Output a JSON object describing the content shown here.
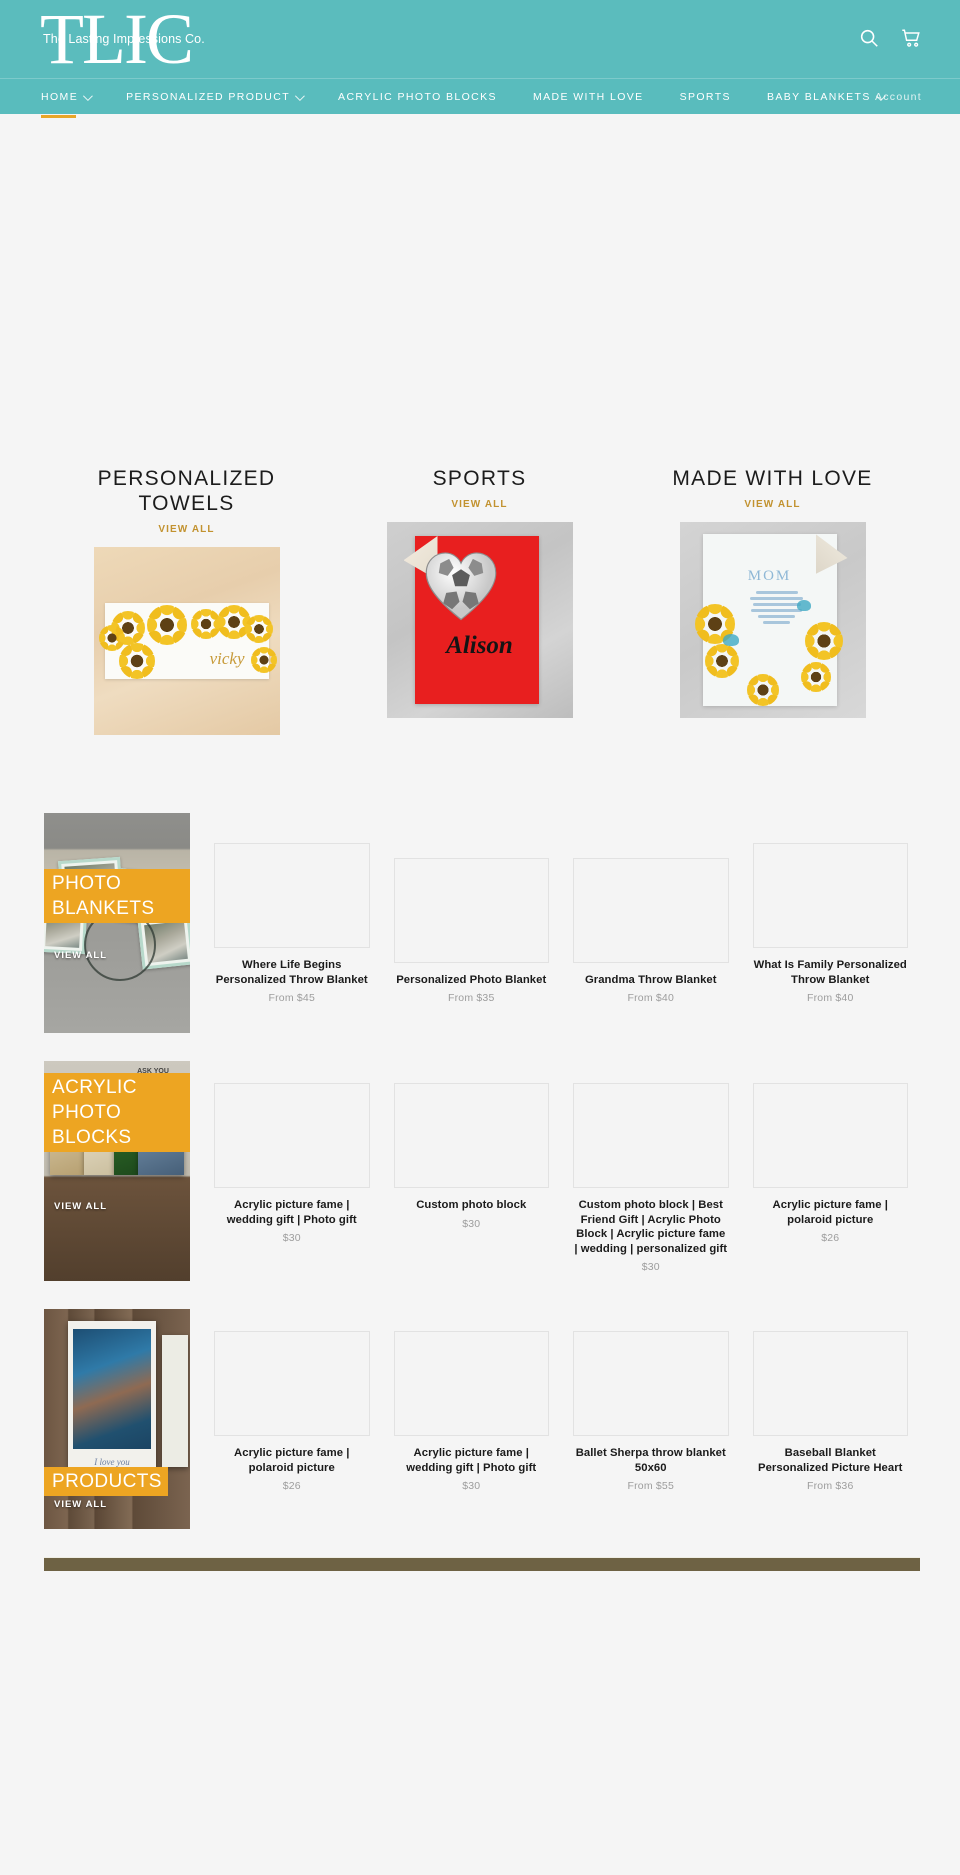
{
  "header": {
    "logo_main": "TLIC",
    "logo_sub": "The Lasting Impressions Co.",
    "search_icon": "search-icon",
    "cart_icon": "shopping-cart-icon"
  },
  "nav": {
    "items": [
      {
        "label": "HOME",
        "has_chevron": true,
        "active": true
      },
      {
        "label": "PERSONALIZED PRODUCT",
        "has_chevron": true,
        "active": false
      },
      {
        "label": "ACRYLIC PHOTO BLOCKS",
        "has_chevron": false,
        "active": false
      },
      {
        "label": "MADE WITH LOVE",
        "has_chevron": false,
        "active": false
      },
      {
        "label": "SPORTS",
        "has_chevron": false,
        "active": false
      },
      {
        "label": "BABY BLANKETS",
        "has_chevron": true,
        "active": false
      }
    ],
    "account_label": "Account"
  },
  "featured_collections": [
    {
      "title": "PERSONALIZED TOWELS",
      "view_all": "VIEW ALL",
      "image_alt": "sunflower-beach-towel-vicky",
      "name_on_product": "vicky"
    },
    {
      "title": "SPORTS",
      "view_all": "VIEW ALL",
      "image_alt": "red-soccer-heart-blanket-alison",
      "name_on_product": "Alison"
    },
    {
      "title": "MADE WITH LOVE",
      "view_all": "VIEW ALL",
      "image_alt": "sunflower-mom-poem-blanket",
      "name_on_product": "MOM"
    }
  ],
  "collection_rows": [
    {
      "tile": {
        "label": "PHOTO BLANKETS",
        "view_all": "VIEW ALL",
        "image_alt": "where-life-begins-family-photo-blanket"
      },
      "products": [
        {
          "title": "Where Life Begins Personalized Throw Blanket",
          "price": "From $45"
        },
        {
          "title": "Personalized Photo Blanket",
          "price": "From $35"
        },
        {
          "title": "Grandma Throw Blanket",
          "price": "From $40"
        },
        {
          "title": "What Is Family Personalized Throw Blanket",
          "price": "From $40"
        }
      ]
    },
    {
      "tile": {
        "label": "ACRYLIC PHOTO BLOCKS",
        "view_all": "VIEW ALL",
        "image_alt": "acrylic-photo-blocks-on-wood"
      },
      "products": [
        {
          "title": "Acrylic picture fame | wedding gift | Photo gift",
          "price": "$30"
        },
        {
          "title": "Custom photo block",
          "price": "$30"
        },
        {
          "title": "Custom photo block | Best Friend Gift | Acrylic Photo Block | Acrylic picture fame | wedding | personalized gift",
          "price": "$30"
        },
        {
          "title": "Acrylic picture fame | polaroid picture",
          "price": "$26"
        }
      ]
    },
    {
      "tile": {
        "label": "PRODUCTS",
        "view_all": "VIEW ALL",
        "image_alt": "polaroid-acrylic-couple-photo"
      },
      "products": [
        {
          "title": "Acrylic picture fame | polaroid picture",
          "price": "$26"
        },
        {
          "title": "Acrylic picture fame | wedding gift | Photo gift",
          "price": "$30"
        },
        {
          "title": "Ballet Sherpa throw blanket 50x60",
          "price": "From $55"
        },
        {
          "title": "Baseball Blanket Personalized Picture Heart",
          "price": "From $36"
        }
      ]
    }
  ],
  "colors": {
    "brand_teal": "#5bbcbd",
    "accent_gold": "#c2922f",
    "tile_orange": "#eda522",
    "page_bg": "#f5f5f5"
  }
}
